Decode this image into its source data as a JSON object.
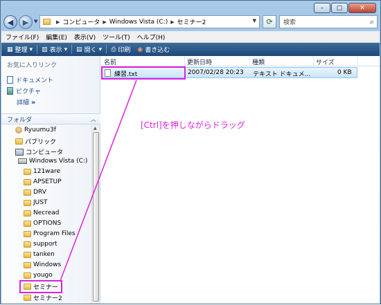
{
  "window": {
    "minimize": "–",
    "maximize": "□",
    "close": "✕"
  },
  "nav": {
    "back_icon": "arrow-left",
    "forward_icon": "arrow-right",
    "breadcrumb": [
      "コンピュータ",
      "Windows Vista (C:)",
      "セミナー2"
    ],
    "refresh_icon": "refresh",
    "search_placeholder": "検索"
  },
  "menubar": [
    "ファイル(F)",
    "編集(E)",
    "表示(V)",
    "ツール(T)",
    "ヘルプ(H)"
  ],
  "commandbar": [
    "整理",
    "表示",
    "開く",
    "印刷",
    "書き込む"
  ],
  "favorites": {
    "title": "お気に入りリンク",
    "items": [
      "ドキュメント",
      "ピクチャ"
    ],
    "more": "詳細",
    "more_glyph": "»"
  },
  "folders": {
    "title": "フォルダ",
    "tree": [
      {
        "label": "Ryuumu3f",
        "icon": "user"
      },
      {
        "label": "パブリック",
        "icon": "folder"
      },
      {
        "label": "コンピュータ",
        "icon": "computer"
      },
      {
        "label": "Windows Vista (C:)",
        "icon": "drive"
      },
      {
        "label": "121ware",
        "icon": "folder"
      },
      {
        "label": "APSETUP",
        "icon": "folder"
      },
      {
        "label": "DRV",
        "icon": "folder"
      },
      {
        "label": "JUST",
        "icon": "folder"
      },
      {
        "label": "Necread",
        "icon": "folder"
      },
      {
        "label": "OPTIONS",
        "icon": "folder"
      },
      {
        "label": "Program Files",
        "icon": "folder"
      },
      {
        "label": "support",
        "icon": "folder"
      },
      {
        "label": "tanken",
        "icon": "folder"
      },
      {
        "label": "Windows",
        "icon": "folder"
      },
      {
        "label": "yougo",
        "icon": "folder"
      },
      {
        "label": "セミナー",
        "icon": "folder"
      },
      {
        "label": "セミナー2",
        "icon": "folder"
      }
    ]
  },
  "columns": [
    "名前",
    "更新日時",
    "種類",
    "サイズ"
  ],
  "files": [
    {
      "name": "練習.txt",
      "modified": "2007/02/28 20:23",
      "type": "テキスト ドキュメ...",
      "size": "0 KB"
    }
  ],
  "annotation": {
    "text": "[Ctrl]を押しながらドラッグ",
    "color": "#e020e0"
  }
}
